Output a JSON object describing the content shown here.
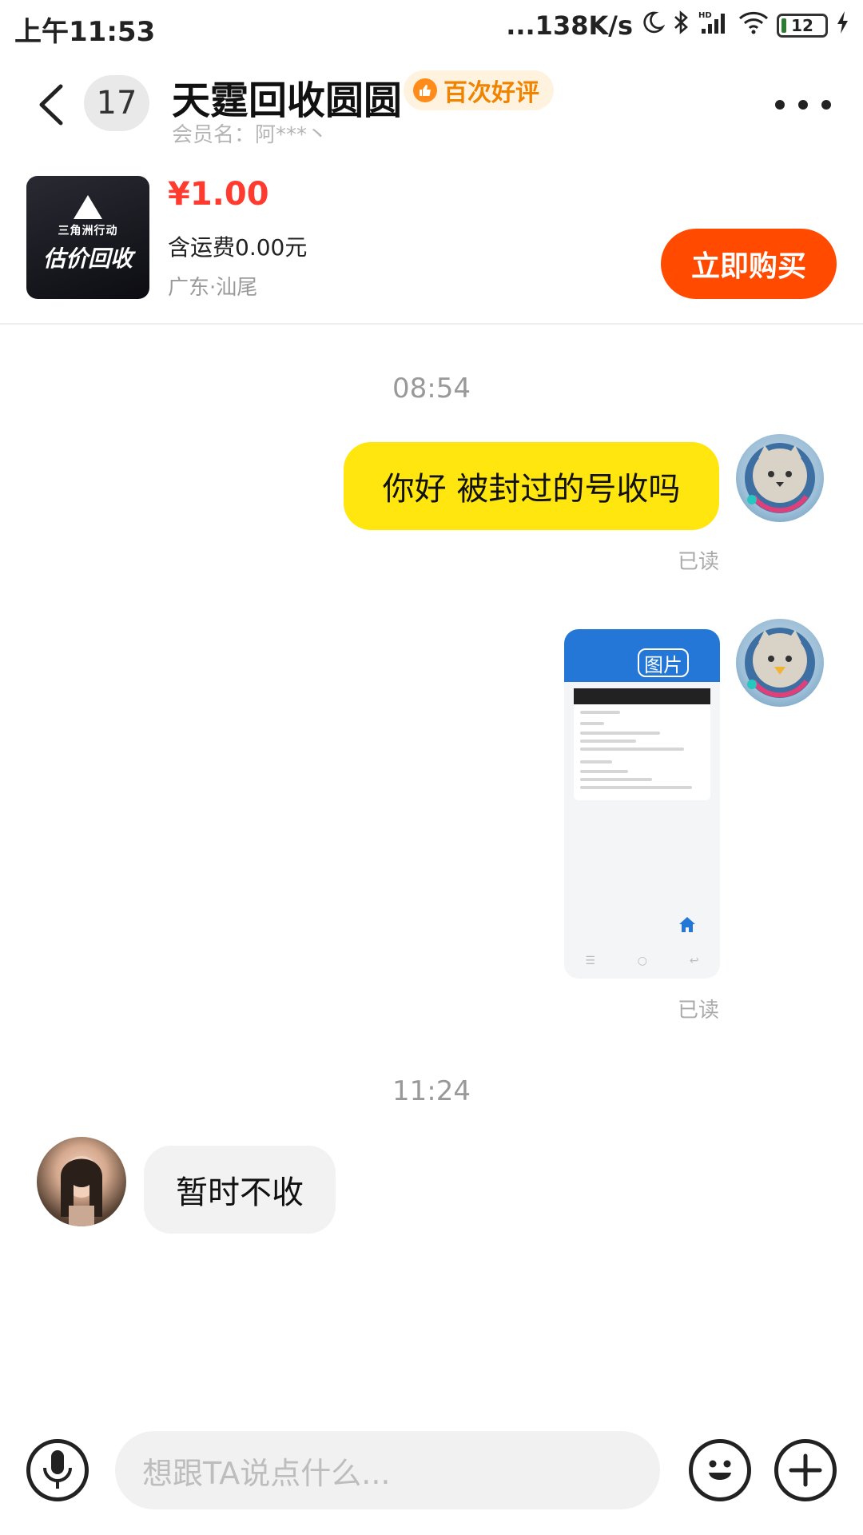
{
  "status_bar": {
    "time": "上午11:53",
    "network_speed": "...138K/s",
    "battery": "12",
    "battery_level": 0.12,
    "icons": [
      "moon-icon",
      "bluetooth-icon",
      "hd-signal-icon",
      "wifi-icon",
      "battery-icon",
      "charging-icon"
    ]
  },
  "header": {
    "unread_count": "17",
    "title": "天霆回收圆圆",
    "rating_badge": "百次好评",
    "member_name": "会员名：阿***丶"
  },
  "product": {
    "image_subtitle": "三角洲行动",
    "image_title": "估价回收",
    "price": "¥1.00",
    "shipping": "含运费0.00元",
    "location": "广东·汕尾",
    "buy_label": "立即购买"
  },
  "messages": [
    {
      "time": "08:54"
    },
    {
      "direction": "out",
      "type": "text",
      "text": "你好 被封过的号收吗",
      "status": "已读"
    },
    {
      "direction": "out",
      "type": "image",
      "image_label": "图片",
      "status": "已读"
    },
    {
      "time": "11:24"
    },
    {
      "direction": "in",
      "type": "text",
      "text": "暂时不收"
    }
  ],
  "input": {
    "placeholder": "想跟TA说点什么..."
  },
  "colors": {
    "accent_orange": "#ff4a00",
    "price_red": "#ff3b30",
    "outgoing_bubble": "#ffe60f",
    "incoming_bubble": "#f2f2f2",
    "rating_text": "#f08300"
  }
}
